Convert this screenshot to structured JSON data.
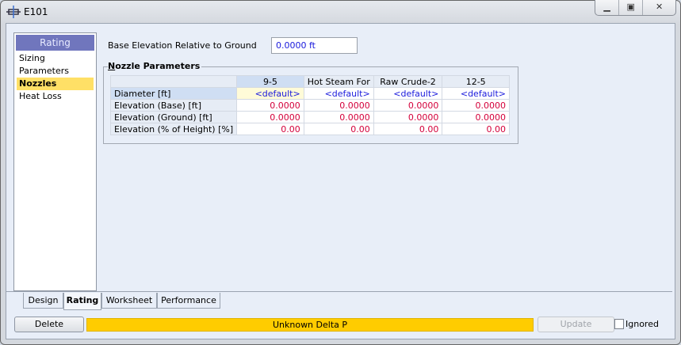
{
  "window": {
    "title": "E101",
    "minimize_icon": "minimize-icon",
    "maximize_icon": "maximize-icon",
    "close_icon": "close-icon"
  },
  "nav": {
    "header": "Rating",
    "items": [
      {
        "label": "Sizing"
      },
      {
        "label": "Parameters"
      },
      {
        "label": "Nozzles",
        "selected": true
      },
      {
        "label": "Heat Loss"
      }
    ]
  },
  "base_elevation": {
    "label": "Base Elevation Relative to Ground",
    "value": "0.0000 ft"
  },
  "nozzle_parameters": {
    "title": "Nozzle Parameters",
    "columns": [
      "9-5",
      "Hot Steam For HE",
      "Raw Crude-2",
      "12-5"
    ],
    "rows": [
      {
        "label": "Diameter [ft]",
        "values": [
          "<default>",
          "<default>",
          "<default>",
          "<default>"
        ]
      },
      {
        "label": "Elevation (Base) [ft]",
        "values": [
          "0.0000",
          "0.0000",
          "0.0000",
          "0.0000"
        ]
      },
      {
        "label": "Elevation (Ground) [ft]",
        "values": [
          "0.0000",
          "0.0000",
          "0.0000",
          "0.0000"
        ]
      },
      {
        "label": "Elevation (% of Height) [%]",
        "values": [
          "0.00",
          "0.00",
          "0.00",
          "0.00"
        ]
      }
    ]
  },
  "tabs": [
    {
      "label": "Design"
    },
    {
      "label": "Rating",
      "active": true
    },
    {
      "label": "Worksheet"
    },
    {
      "label": "Performance"
    }
  ],
  "footer": {
    "delete_label": "Delete",
    "status": "Unknown Delta P",
    "status_color": "#ffcc00",
    "update_label": "Update",
    "ignored_label": "Ignored",
    "ignored_checked": false
  },
  "colors": {
    "nav_header": "#7076bd",
    "selected_item": "#ffe066",
    "value_text": "#d4003a",
    "default_text": "#1a1adc"
  }
}
